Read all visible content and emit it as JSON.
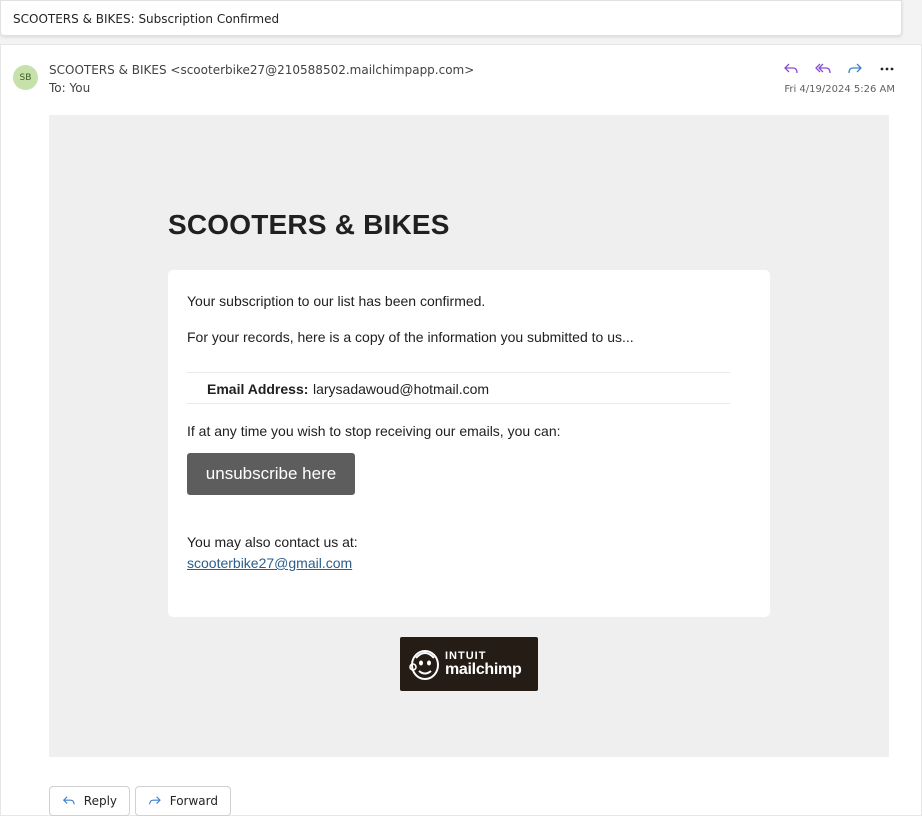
{
  "subject": "SCOOTERS & BIKES: Subscription Confirmed",
  "header": {
    "avatar_initials": "SB",
    "from": "SCOOTERS & BIKES <scooterbike27@210588502.mailchimpapp.com>",
    "to": "To: You",
    "date": "Fri 4/19/2024 5:26 AM",
    "actions": [
      "reply-icon",
      "reply-all-icon",
      "forward-icon",
      "more-icon"
    ]
  },
  "body": {
    "brand": "SCOOTERS & BIKES",
    "confirmed_text": "Your subscription to our list has been confirmed.",
    "records_text": "For your records, here is a copy of the information you submitted to us...",
    "email_label": "Email Address:",
    "email_value": "larysadawoud@hotmail.com",
    "stop_text": "If at any time you wish to stop receiving our emails, you can:",
    "unsubscribe_label": "unsubscribe here",
    "contact_text": "You may also contact us at:",
    "contact_email": "scooterbike27@gmail.com",
    "badge_line1": "INTUIT",
    "badge_line2": "mailchimp"
  },
  "footer": {
    "reply_label": "Reply",
    "forward_label": "Forward"
  },
  "colors": {
    "accent_purple": "#8a4fd0",
    "accent_blue": "#3f7fd0",
    "button_gray": "#5d5d5d",
    "link_blue": "#2b5e8c"
  }
}
